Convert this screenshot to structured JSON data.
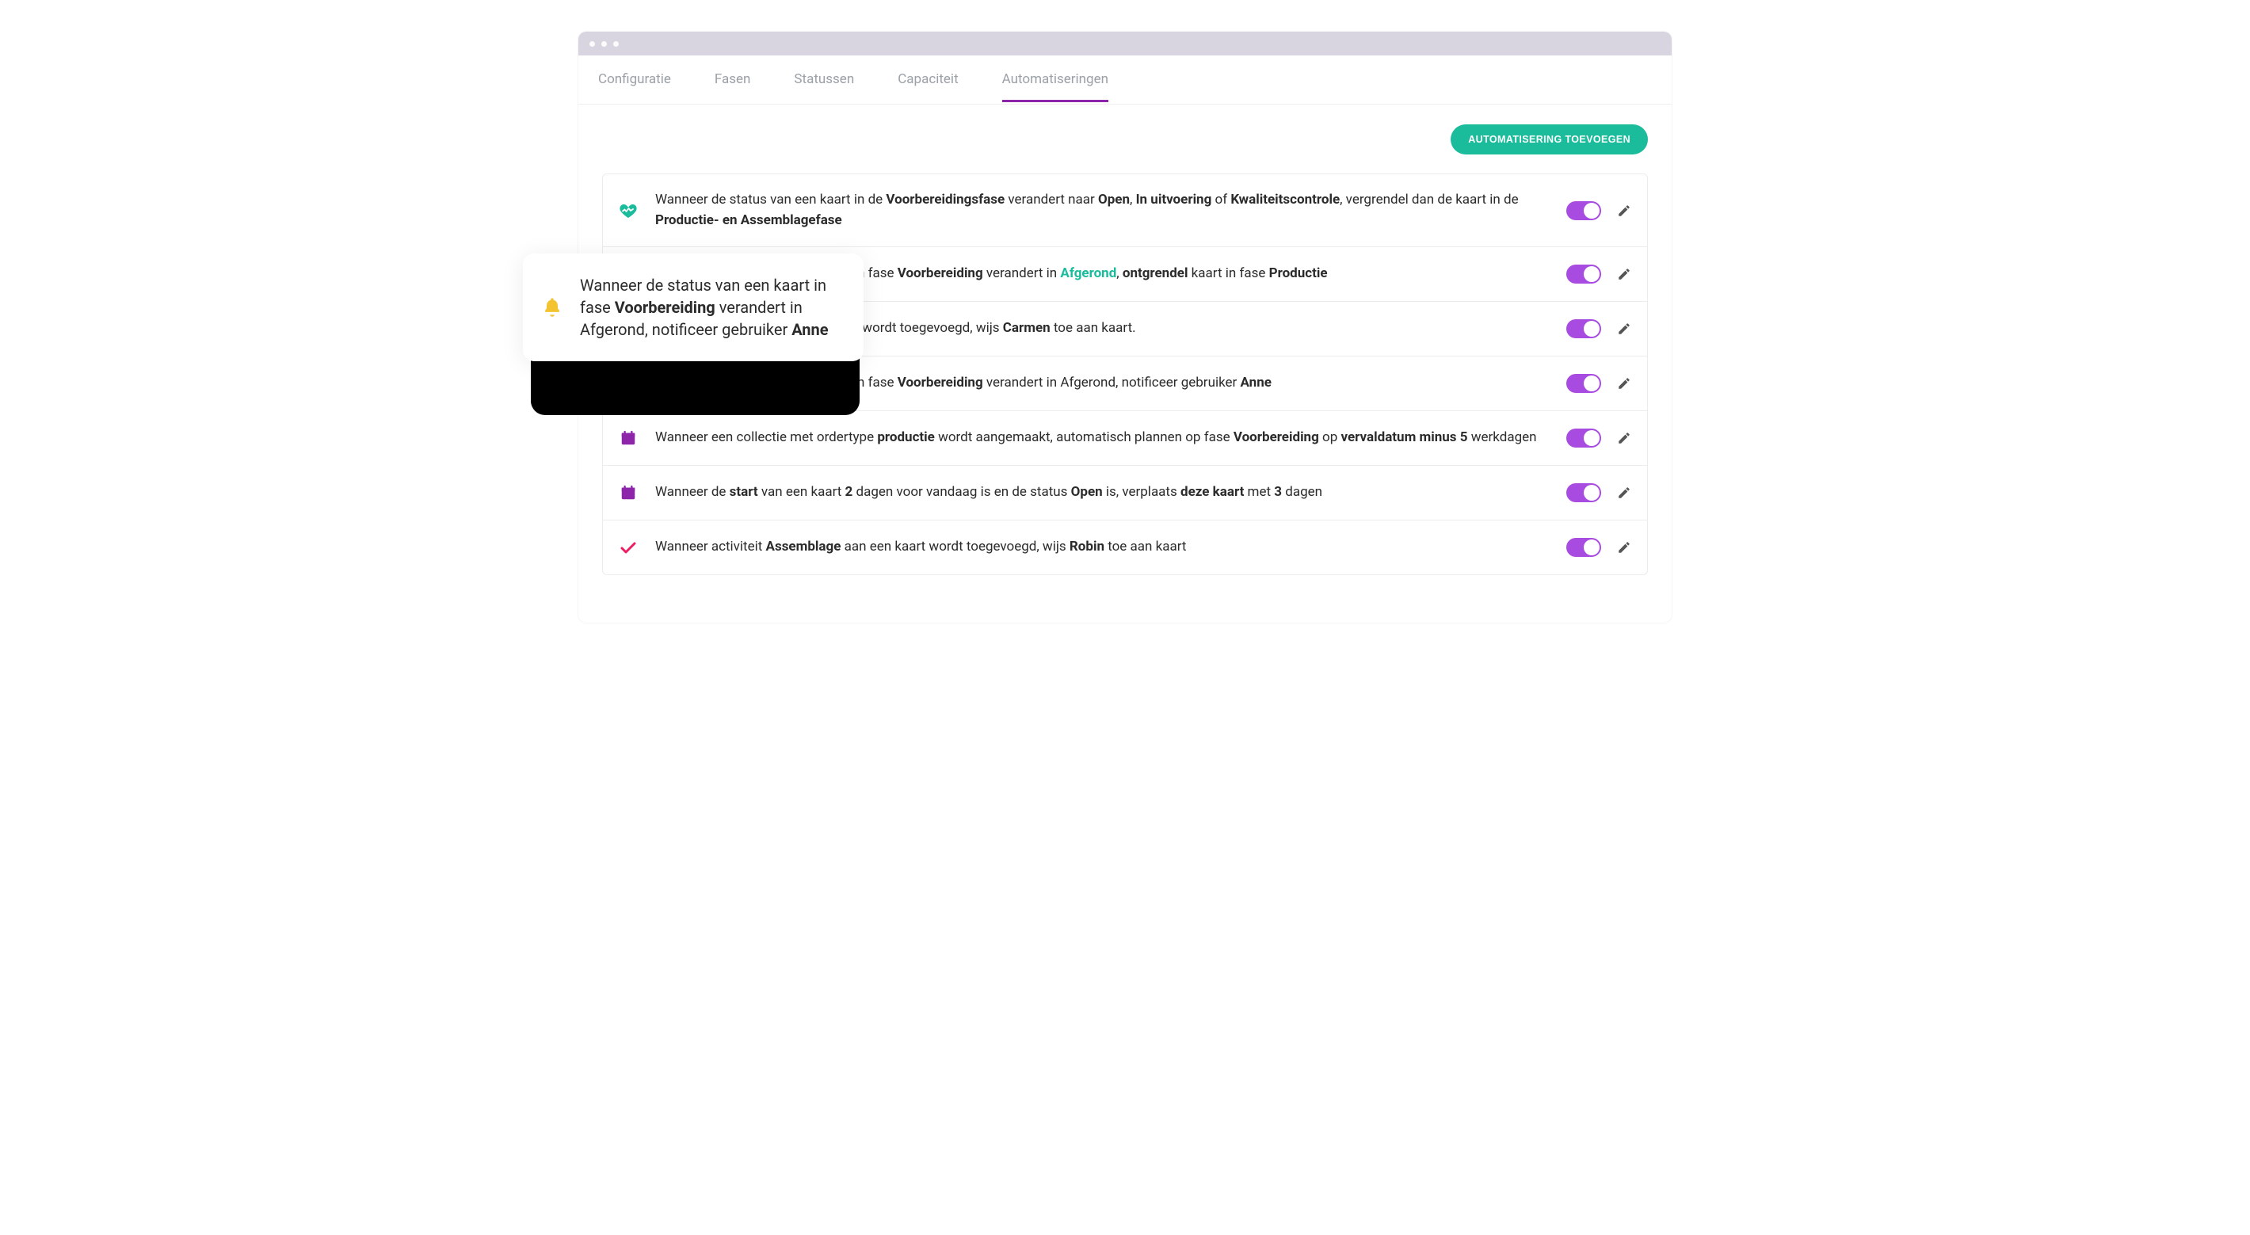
{
  "tabs": [
    "Configuratie",
    "Fasen",
    "Statussen",
    "Capaciteit",
    "Automatiseringen"
  ],
  "activeTab": 4,
  "addButton": "AUTOMATISERING TOEVOEGEN",
  "rules": [
    {
      "icon": "heart",
      "html": "Wanneer de status van een kaart in de <b>Voorbereidingsfase</b> verandert naar <b>Open</b>, <b>In uitvoering</b> of <b>Kwaliteitscontrole</b>, vergrendel dan de kaart in de <b>Productie- en Assemblagefase</b>"
    },
    {
      "icon": "unlock",
      "html": "Wanneer de status van een kaart in fase <b>Voorbereiding</b> verandert in <span class=\"hl\">Afgerond</span>, <b>ontgrendel</b> kaart in fase <b>Productie</b>"
    },
    {
      "icon": "user",
      "html": "Wanneer fase <b>Productie</b> aan kaart wordt toegevoegd, wijs <b>Carmen</b> toe aan kaart."
    },
    {
      "icon": "bell",
      "html": "Wanneer de status van een kaart in fase <b>Voorbereiding</b> verandert in Afgerond, notificeer gebruiker <b>Anne</b>"
    },
    {
      "icon": "calendar",
      "html": "Wanneer een collectie met ordertype <b>productie</b> wordt aangemaakt, automatisch plannen op fase <b>Voorbereiding</b> op <b>vervaldatum minus 5</b> werkdagen"
    },
    {
      "icon": "calendar",
      "html": "Wanneer de <b>start</b> van een kaart <b>2</b> dagen voor vandaag is en de status <b>Open</b> is, verplaats <b>deze kaart</b> met <b>3</b> dagen"
    },
    {
      "icon": "check",
      "html": "Wanneer activiteit <b>Assemblage</b> aan een kaart wordt toegevoegd, wijs <b>Robin</b> toe aan kaart"
    }
  ],
  "popout": {
    "html": "Wanneer de status van een kaart in fase <b>Voorbereiding</b> verandert in Afgerond, notificeer gebruiker <b>Anne</b>"
  }
}
